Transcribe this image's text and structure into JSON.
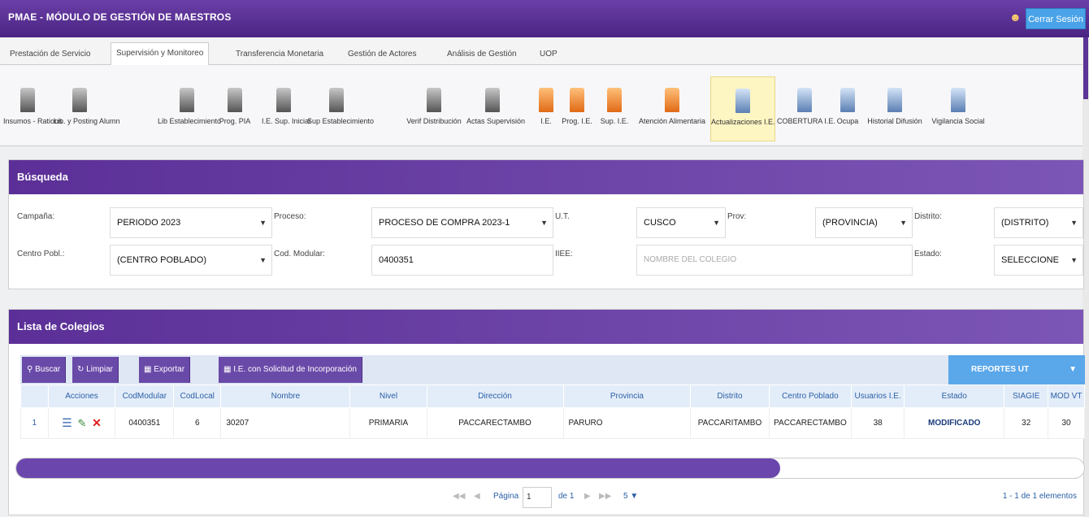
{
  "header": {
    "title": "PMAE - MÓDULO DE GESTIÓN DE MAESTROS",
    "user_icon": "user-icon",
    "logout_label": "Cerrar Sesión"
  },
  "tabs": [
    {
      "label": "Prestación de Servicio"
    },
    {
      "label": "Supervisión y Monitoreo",
      "active": true
    },
    {
      "label": "Transferencia Monetaria"
    },
    {
      "label": "Gestión de Actores"
    },
    {
      "label": "Análisis de Gestión"
    },
    {
      "label": "UOP"
    }
  ],
  "toolbar": [
    {
      "label": "Insumos - Rations",
      "color": "gray"
    },
    {
      "label": "Lib. y Posting Alumn",
      "color": "gray"
    },
    {
      "label": "Lib Establecimiento",
      "color": "gray"
    },
    {
      "label": "Prog. PIA",
      "color": "gray"
    },
    {
      "label": "I.E. Sup. Inicial",
      "color": "gray"
    },
    {
      "label": "Sup Establecimiento",
      "color": "gray"
    },
    {
      "label": "Verif Distribución",
      "color": "gray"
    },
    {
      "label": "Actas Supervisión",
      "color": "gray"
    },
    {
      "label": "I.E.",
      "color": "orange"
    },
    {
      "label": "Prog. I.E.",
      "color": "orange"
    },
    {
      "label": "Sup. I.E.",
      "color": "orange"
    },
    {
      "label": "Atención Alimentaria",
      "color": "orange"
    },
    {
      "label": "Actualizaciones I.E.",
      "color": "blue",
      "active": true
    },
    {
      "label": "COBERTURA I.E.",
      "color": "blue"
    },
    {
      "label": "Ocupa",
      "color": "blue"
    },
    {
      "label": "Historial Difusión",
      "color": "blue"
    },
    {
      "label": "Vigilancia Social",
      "color": "blue"
    }
  ],
  "search": {
    "title": "Búsqueda",
    "campania_label": "Campaña:",
    "campania_value": "PERIODO 2023",
    "proceso_label": "Proceso:",
    "proceso_value": "PROCESO DE COMPRA 2023-1",
    "ut_label": "U.T.",
    "ut_value": "CUSCO",
    "prov_label": "Prov:",
    "prov_value": "(PROVINCIA)",
    "distrito_label": "Distrito:",
    "distrito_value": "(DISTRITO)",
    "centro_label": "Centro Pobl.:",
    "centro_value": "(CENTRO POBLADO)",
    "codmod_label": "Cod. Modular:",
    "codmod_value": "0400351",
    "iiee_label": "IIEE:",
    "iiee_placeholder": "NOMBRE DEL COLEGIO",
    "estado_label": "Estado:",
    "estado_value": "SELECCIONE"
  },
  "list": {
    "title": "Lista de Colegios",
    "buttons": {
      "buscar": "Buscar",
      "limpiar": "Limpiar",
      "exportar": "Exportar",
      "solicitud": "I.E. con Solicitud de Incorporación"
    },
    "reportes": "REPORTES UT",
    "columns": [
      "",
      "Acciones",
      "CodModular",
      "CodLocal",
      "Nombre",
      "Nivel",
      "Dirección",
      "Provincia",
      "Distrito",
      "Centro Poblado",
      "Usuarios I.E.",
      "Estado",
      "SIAGIE",
      "MOD VT"
    ],
    "rows": [
      [
        "1",
        "",
        "0400351",
        "6",
        "30207",
        "PRIMARIA",
        "PACCARECTAMBO",
        "PARURO",
        "PACCARITAMBO",
        "PACCARECTAMBO",
        "38",
        "MODIFICADO",
        "32",
        "30"
      ]
    ],
    "pager": {
      "page_label": "Página",
      "page": "1",
      "of_label": "de 1",
      "page_size": "5",
      "summary": "1 - 1 de 1 elementos"
    }
  }
}
